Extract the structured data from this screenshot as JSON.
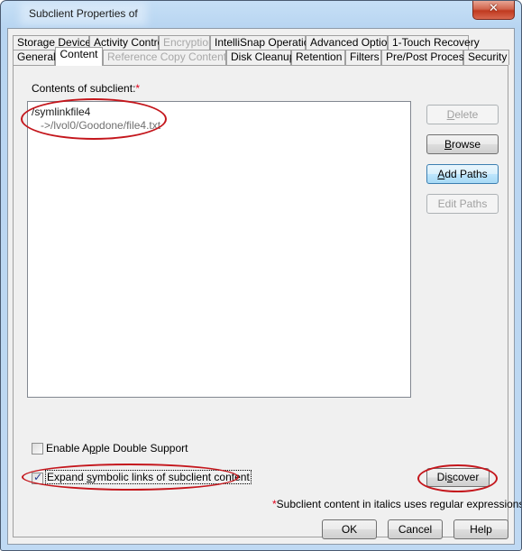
{
  "window": {
    "title": "Subclient Properties of",
    "close_glyph": "✕"
  },
  "tabs": {
    "row1": [
      {
        "label": "Storage Device",
        "state": "normal"
      },
      {
        "label": "Activity Control",
        "state": "normal"
      },
      {
        "label": "Encryption",
        "state": "disabled"
      },
      {
        "label": "IntelliSnap Operations",
        "state": "normal"
      },
      {
        "label": "Advanced Options",
        "state": "normal"
      },
      {
        "label": "1-Touch Recovery",
        "state": "normal"
      }
    ],
    "row2": [
      {
        "label": "General",
        "state": "normal"
      },
      {
        "label": "Content",
        "state": "active"
      },
      {
        "label": "Reference Copy Contents",
        "state": "disabled"
      },
      {
        "label": "Disk Cleanup",
        "state": "normal"
      },
      {
        "label": "Retention",
        "state": "normal"
      },
      {
        "label": "Filters",
        "state": "normal"
      },
      {
        "label": "Pre/Post Process",
        "state": "normal"
      },
      {
        "label": "Security",
        "state": "normal"
      }
    ]
  },
  "content": {
    "contents_label": "Contents of subclient:",
    "required_marker": "*",
    "items": [
      {
        "path": "/symlinkfile4",
        "target": "->/lvol0/Goodone/file4.txt"
      }
    ],
    "buttons": {
      "delete": {
        "label_accel": "D",
        "label_rest": "elete",
        "enabled": false
      },
      "browse": {
        "label_accel": "B",
        "label_rest": "rowse",
        "enabled": true
      },
      "add_paths": {
        "label_accel": "A",
        "label_rest": "dd Paths",
        "enabled": true
      },
      "edit_paths": {
        "label": "Edit Paths",
        "enabled": false
      },
      "discover": {
        "label_pre": "Di",
        "label_accel": "s",
        "label_rest": "cover",
        "enabled": true
      }
    },
    "checkboxes": {
      "apple_double": {
        "label_pre": "Enable A",
        "label_accel": "p",
        "label_rest": "ple Double Support",
        "checked": false
      },
      "expand_symlinks": {
        "label_pre": "Expand ",
        "label_accel": "s",
        "label_rest": "ymbolic links of subclient content",
        "checked": true
      }
    },
    "footnote_marker": "*",
    "footnote": "Subclient content in italics uses regular expressions"
  },
  "footer": {
    "ok": "OK",
    "cancel": "Cancel",
    "help": "Help"
  },
  "colors": {
    "annotation_red": "#c4161c",
    "required_red": "#e0001a",
    "focus_blue": "#3c7fb1"
  }
}
